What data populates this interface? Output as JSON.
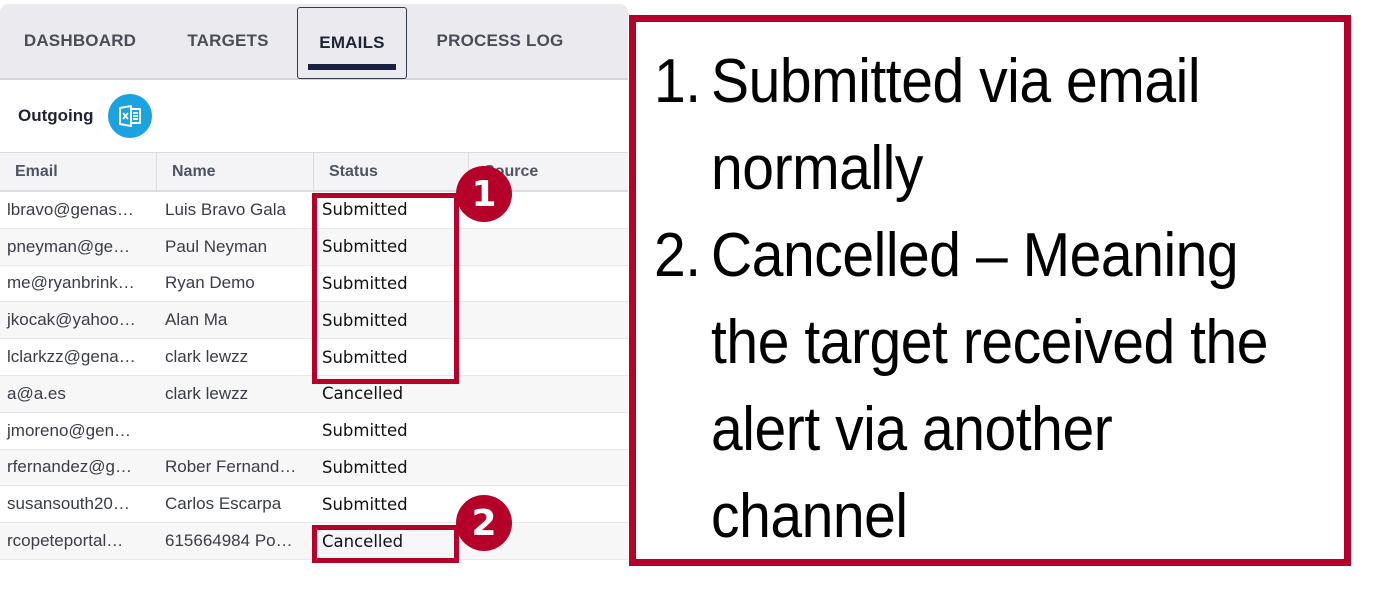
{
  "tabs": [
    {
      "label": "DASHBOARD",
      "active": false
    },
    {
      "label": "TARGETS",
      "active": false
    },
    {
      "label": "EMAILS",
      "active": true
    },
    {
      "label": "PROCESS LOG",
      "active": false
    }
  ],
  "section": {
    "title": "Outgoing",
    "export_icon": "excel-export-icon"
  },
  "table": {
    "columns": [
      "Email",
      "Name",
      "Status",
      "Source"
    ],
    "rows": [
      {
        "email": "lbravo@genas…",
        "name": "Luis Bravo Gala",
        "status": "Submitted",
        "source": ""
      },
      {
        "email": "pneyman@ge…",
        "name": "Paul Neyman",
        "status": "Submitted",
        "source": ""
      },
      {
        "email": "me@ryanbrink…",
        "name": "Ryan Demo",
        "status": "Submitted",
        "source": ""
      },
      {
        "email": "jkocak@yahoo…",
        "name": "Alan Ma",
        "status": "Submitted",
        "source": ""
      },
      {
        "email": "lclarkzz@gena…",
        "name": "clark lewzz",
        "status": "Submitted",
        "source": ""
      },
      {
        "email": "a@a.es",
        "name": "clark lewzz",
        "status": "Cancelled",
        "source": ""
      },
      {
        "email": "jmoreno@gen…",
        "name": "",
        "status": "Submitted",
        "source": ""
      },
      {
        "email": "rfernandez@g…",
        "name": "Rober Fernand…",
        "status": "Submitted",
        "source": ""
      },
      {
        "email": "susansouth20…",
        "name": "Carlos Escarpa",
        "status": "Submitted",
        "source": ""
      },
      {
        "email": "rcopeteportal…",
        "name": "615664984 Po…",
        "status": "Cancelled",
        "source": ""
      }
    ]
  },
  "annotations": {
    "color": "#b5002a",
    "badge_1": "1",
    "badge_2": "2"
  },
  "callout": {
    "items": [
      {
        "num": "1.",
        "text": "Submitted via email normally"
      },
      {
        "num": "2.",
        "text": "Cancelled – Meaning the target received the alert via another channel"
      }
    ]
  }
}
